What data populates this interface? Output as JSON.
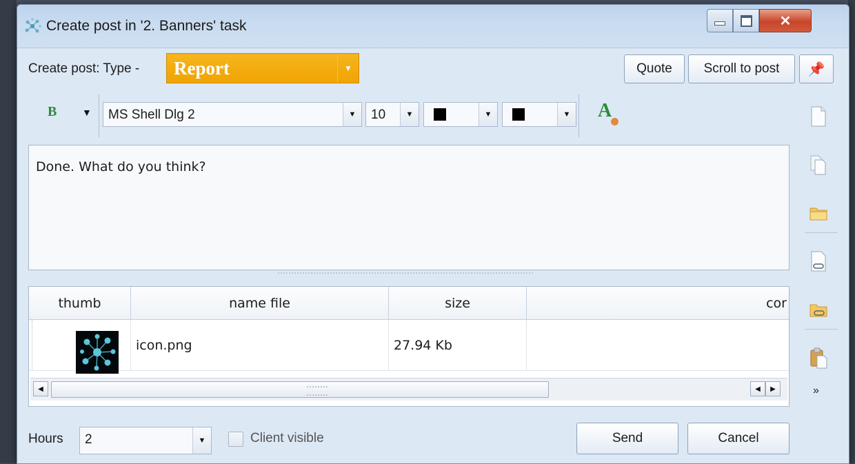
{
  "window": {
    "title": "Create post in '2. Banners' task"
  },
  "post": {
    "type_label": "Create post: Type -",
    "type_value": "Report",
    "quote_label": "Quote",
    "scroll_label": "Scroll to post"
  },
  "toolbar": {
    "bold_label": "B",
    "font_name": "MS Shell Dlg 2",
    "font_size": "10",
    "font_color": "#000000",
    "highlight_color": "#000000",
    "font_style_label": "A"
  },
  "editor": {
    "text": "Done. What do you think?"
  },
  "attachments": {
    "columns": [
      "thumb",
      "name file",
      "size",
      "cor"
    ],
    "rows": [
      {
        "name_file": "icon.png",
        "size": "27.94 Kb"
      }
    ]
  },
  "footer": {
    "hours_label": "Hours",
    "hours_value": "2",
    "client_visible_label": "Client visible",
    "client_visible_checked": false,
    "send_label": "Send",
    "cancel_label": "Cancel"
  },
  "colors": {
    "type_select_bg": "#f0a400",
    "window_bg": "#dde8f5",
    "close_button": "#c8452a"
  }
}
